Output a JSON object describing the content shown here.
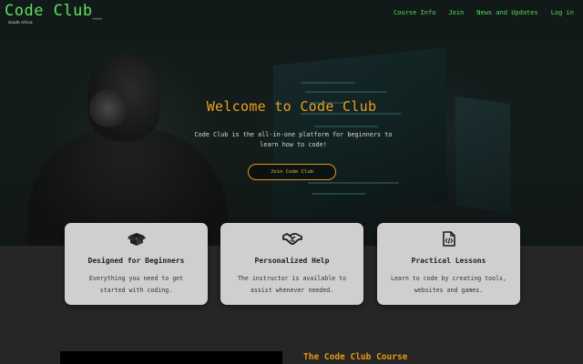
{
  "logo": {
    "title": "Code Club_",
    "subtitle": "South Africa"
  },
  "nav": {
    "items": [
      "Course Info",
      "Join",
      "News and Updates",
      "Log in"
    ]
  },
  "hero": {
    "title": "Welcome to Code Club",
    "text": "Code Club is the all-in-one platform for beginners to learn how to code!",
    "cta_label": "Join Code Club"
  },
  "cards": [
    {
      "icon": "open-box-icon",
      "title": "Designed for Beginners",
      "text": "Everything you need to get started with coding."
    },
    {
      "icon": "handshake-icon",
      "title": "Personalized Help",
      "text": "The instructor is available to assist whenever needed."
    },
    {
      "icon": "code-file-icon",
      "title": "Practical Lessons",
      "text": "Learn to code by creating tools, websites and games."
    }
  ],
  "course": {
    "title": "The Code Club Course"
  },
  "colors": {
    "accent_green": "#5fe05f",
    "accent_orange": "#e8a11e",
    "card_bg": "#cfcfcf",
    "page_bg": "#262626"
  }
}
